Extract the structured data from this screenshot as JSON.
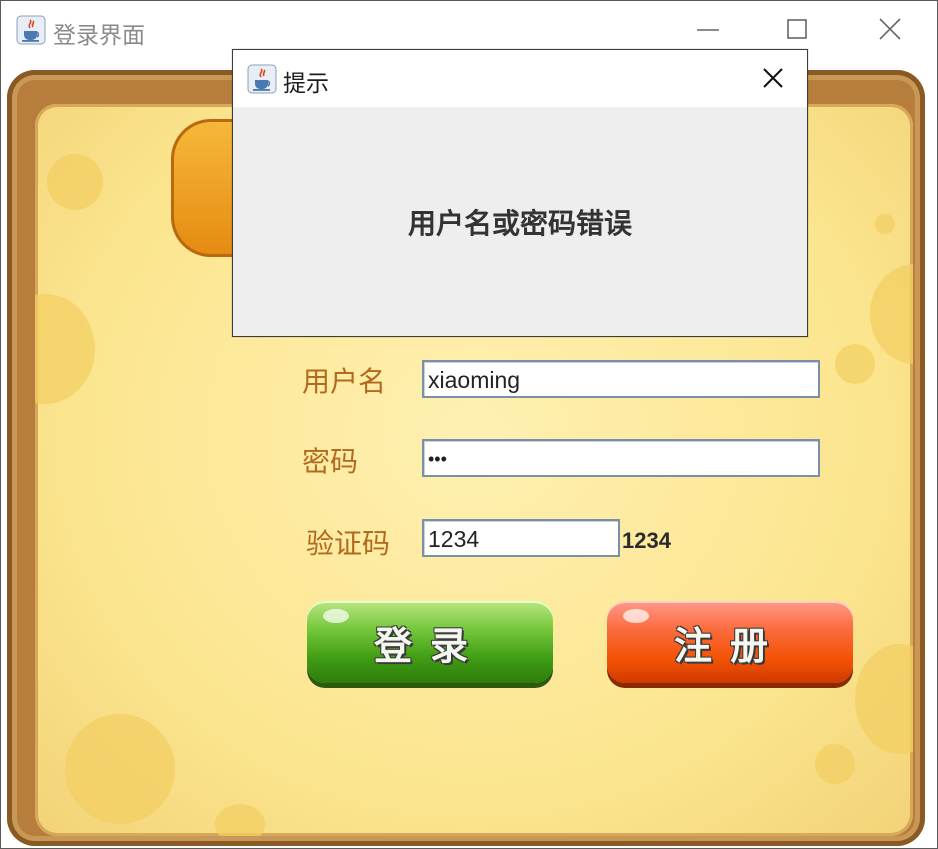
{
  "window": {
    "title": "登录界面",
    "icon": "java-cup-icon",
    "controls": [
      "minimize-icon",
      "maximize-icon",
      "close-icon"
    ]
  },
  "form": {
    "username_label": "用户名",
    "username_value": "xiaoming",
    "password_label": "密码",
    "password_value": "•••",
    "captcha_label": "验证码",
    "captcha_value": "1234",
    "captcha_display": "1234",
    "login_button": "登录",
    "register_button": "注册"
  },
  "dialog": {
    "title": "提示",
    "message": "用户名或密码错误"
  },
  "colors": {
    "label": "#b26a1e",
    "login_button": "#3f9c14",
    "register_button": "#f45306",
    "parchment": "#fbe58e",
    "frame": "#b77d3c"
  }
}
